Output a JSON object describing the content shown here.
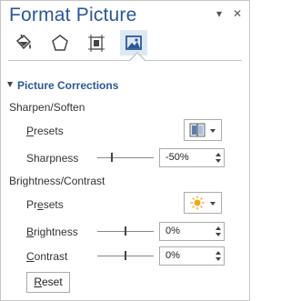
{
  "pane": {
    "title": "Format Picture",
    "options_icon": "chevron-down-icon",
    "close_icon": "close-icon",
    "close_glyph": "✕",
    "options_glyph": "▾"
  },
  "tabs": [
    {
      "name": "fill-line",
      "icon": "paint-bucket-icon",
      "selected": false
    },
    {
      "name": "effects",
      "icon": "pentagon-icon",
      "selected": false
    },
    {
      "name": "size-properties",
      "icon": "size-properties-icon",
      "selected": false
    },
    {
      "name": "picture",
      "icon": "picture-icon",
      "selected": true
    }
  ],
  "section": {
    "title": "Picture Corrections",
    "expanded": true
  },
  "sharpen": {
    "group_label": "Sharpen/Soften",
    "presets_label_pre": "",
    "presets_label_ul": "P",
    "presets_label_post": "resets",
    "sharpness_label_pre": "Sharpness",
    "sharpness_value": "-50%",
    "sharpness_level": -50
  },
  "brightness": {
    "group_label": "Brightness/Contrast",
    "presets_label_pre": "Pr",
    "presets_label_ul": "e",
    "presets_label_post": "sets",
    "brightness_label_ul": "B",
    "brightness_label_post": "rightness",
    "brightness_value": "0%",
    "brightness_level": 0,
    "contrast_label_ul": "C",
    "contrast_label_post": "ontrast",
    "contrast_value": "0%",
    "contrast_level": 0
  },
  "reset": {
    "label_ul": "R",
    "label_post": "eset"
  },
  "colors": {
    "accent": "#2b579a",
    "sun": "#f5a623"
  }
}
